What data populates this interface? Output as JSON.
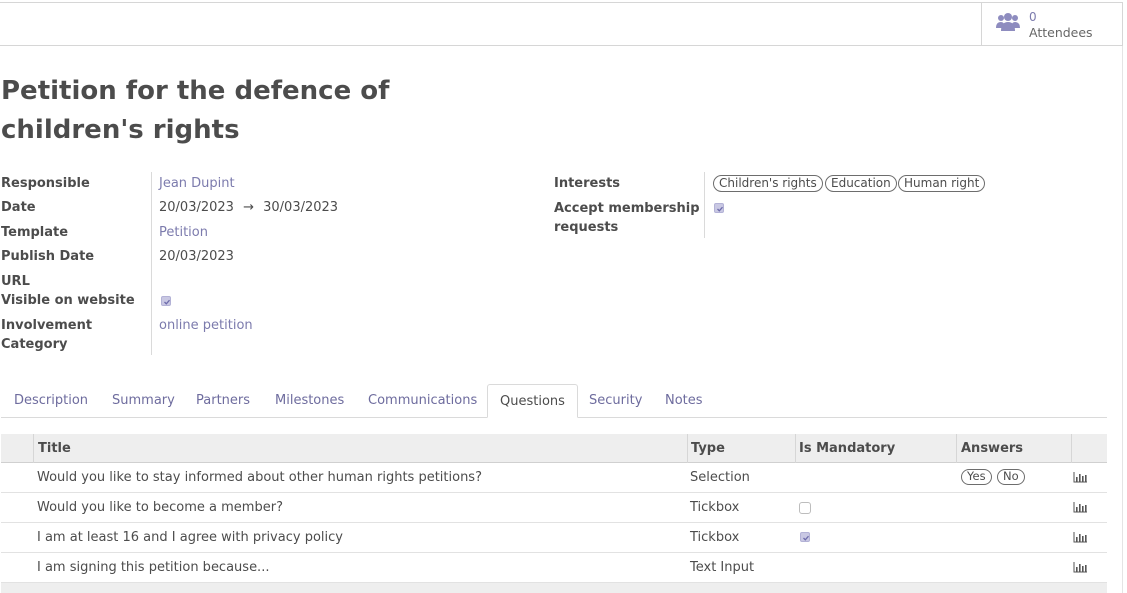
{
  "attendees": {
    "count": "0",
    "label": "Attendees",
    "icon": "users-icon"
  },
  "title": "Petition for the defence of children's rights",
  "fields": {
    "responsible": {
      "label": "Responsible",
      "value": "Jean Dupint"
    },
    "date": {
      "label": "Date",
      "start": "20/03/2023",
      "arrow": "→",
      "end": "30/03/2023"
    },
    "template": {
      "label": "Template",
      "value": "Petition"
    },
    "publish_date": {
      "label": "Publish Date",
      "value": "20/03/2023"
    },
    "url": {
      "label": "URL",
      "value": ""
    },
    "visible_on_website": {
      "label": "Visible on website",
      "checked": true
    },
    "involvement_category": {
      "label_line1": "Involvement",
      "label_line2": "Category",
      "value": "online petition"
    },
    "interests": {
      "label": "Interests",
      "tags": [
        "Children's rights",
        "Education",
        "Human right"
      ]
    },
    "accept_membership": {
      "label_line1": "Accept membership",
      "label_line2": "requests",
      "checked": true
    }
  },
  "tabs": [
    "Description",
    "Summary",
    "Partners",
    "Milestones",
    "Communications",
    "Questions",
    "Security",
    "Notes"
  ],
  "active_tab": "Questions",
  "table": {
    "columns": [
      "Title",
      "Type",
      "Is Mandatory",
      "Answers"
    ],
    "rows": [
      {
        "title": "Would you like to stay informed about other human rights petitions?",
        "type": "Selection",
        "mandatory": null,
        "answers": [
          "Yes",
          "No"
        ]
      },
      {
        "title": "Would you like to become a member?",
        "type": "Tickbox",
        "mandatory": false,
        "answers": []
      },
      {
        "title": "I am at least 16 and I agree with privacy policy",
        "type": "Tickbox",
        "mandatory": true,
        "answers": []
      },
      {
        "title": "I am signing this petition because...",
        "type": "Text Input",
        "mandatory": null,
        "answers": []
      }
    ]
  },
  "colors": {
    "link": "#7c7bad",
    "text": "#4c4c4c",
    "header_bg": "#eeeeee",
    "checkbox": "#c9c8e3"
  }
}
